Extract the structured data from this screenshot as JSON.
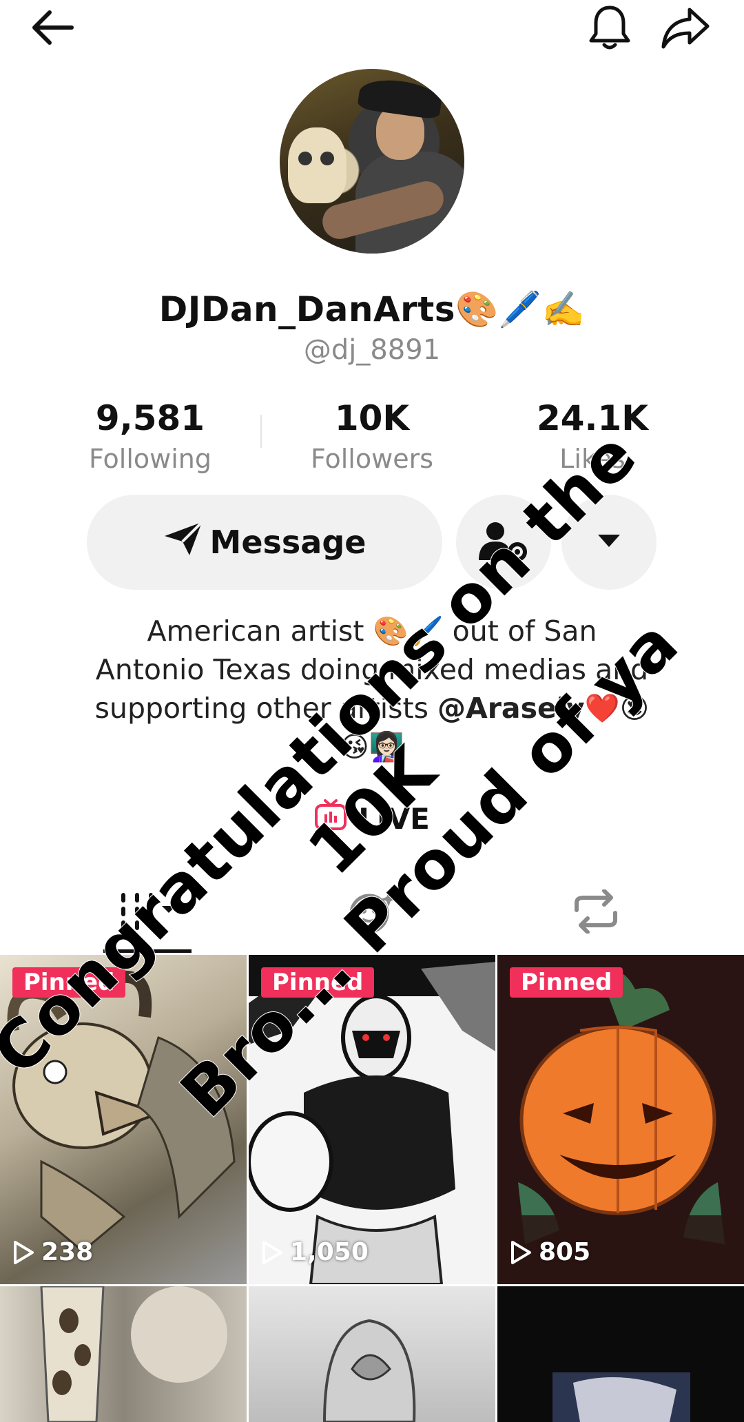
{
  "profile": {
    "display_name": "DJDan_DanArts🎨🖊️✍️",
    "handle": "@dj_8891"
  },
  "stats": [
    {
      "value": "9,581",
      "label": "Following"
    },
    {
      "value": "10K",
      "label": "Followers"
    },
    {
      "value": "24.1K",
      "label": "Likes"
    }
  ],
  "actions": {
    "message_label": "Message"
  },
  "bio": {
    "line1": "American artist 🎨🖌️ out of San",
    "line2": "Antonio Texas doing mixed medias and",
    "line3_prefix": "supporting other artists ",
    "mention": "@Arasely",
    "line3_suffix": "❤️😍",
    "line4": "😘👩🏻‍🏫"
  },
  "live": {
    "label": "LIVE"
  },
  "tabs": [
    "videos-tab",
    "reposts-tab",
    "favorites-tab"
  ],
  "overlay_caption": {
    "line1": "Congratulations on the 10K",
    "line2": "Bro... Proud of ya"
  },
  "videos": [
    {
      "pinned": "Pinned",
      "views": "238"
    },
    {
      "pinned": "Pinned",
      "views": "1,050"
    },
    {
      "pinned": "Pinned",
      "views": "805"
    },
    {
      "pinned": "",
      "views": ""
    },
    {
      "pinned": "",
      "views": ""
    },
    {
      "pinned": "",
      "views": ""
    }
  ],
  "colors": {
    "accent": "#f0305a",
    "muted_text": "#8a8a8a",
    "button_bg": "#f1f1f2"
  }
}
